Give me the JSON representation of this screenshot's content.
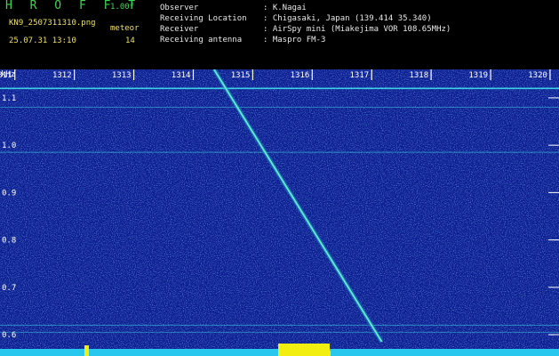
{
  "header": {
    "logo": "H R O F F T",
    "version": "1.00f",
    "filename": "KN9_2507311310.png",
    "meteor_label": "meteor",
    "datetime": "25.07.31 13:10",
    "count": "14",
    "info": [
      {
        "label": "Observer",
        "value": ": K.Nagai"
      },
      {
        "label": "Receiving Location",
        "value": ": Chigasaki, Japan (139.414 35.340)"
      },
      {
        "label": "Receiver",
        "value": ": AirSpy mini (Miakejima VOR 108.65MHz)"
      },
      {
        "label": "Receiving antenna",
        "value": ": Maspro FM-3"
      }
    ]
  },
  "chart_data": {
    "type": "heatmap",
    "time_ticks": [
      "1311",
      "1312",
      "1313",
      "1314",
      "1315",
      "1316",
      "1317",
      "1318",
      "1319",
      "1320"
    ],
    "freq_ticks": [
      "1.1",
      "1.0",
      "0.9",
      "0.8",
      "0.7",
      "0.6"
    ],
    "freq_unit": "kHz",
    "xlim": [
      1310.75,
      1320.15
    ],
    "ylim": [
      0.585,
      1.16
    ],
    "meteor_trace": [
      [
        1314.35,
        1.16
      ],
      [
        1317.17,
        0.585
      ]
    ],
    "carrier_lines_khz": [
      1.12,
      1.08,
      0.985,
      0.62,
      0.605
    ],
    "colors": {
      "background": "#0b1e8f",
      "noise": "#2f58e0",
      "trace": "#5fe8c8",
      "carrier": "#3fd8e8",
      "tick": "#ffffff",
      "bottom_bar": "#28c8ee",
      "burst": "#f2ee10"
    }
  }
}
